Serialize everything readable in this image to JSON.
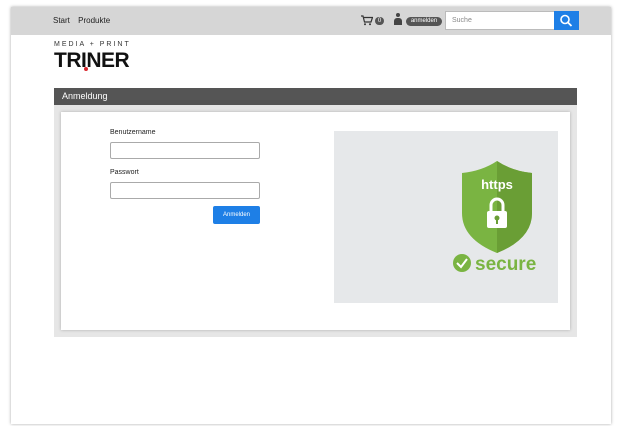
{
  "nav": {
    "start": "Start",
    "products": "Produkte"
  },
  "header": {
    "cart_count": "0",
    "login_label": "anmelden",
    "search_placeholder": "Suche"
  },
  "logo": {
    "top": "MEDIA + PRINT",
    "main": "TRINER"
  },
  "section": {
    "title": "Anmeldung"
  },
  "form": {
    "username_label": "Benutzername",
    "password_label": "Passwort",
    "submit_label": "Anmelden",
    "username_value": "",
    "password_value": ""
  },
  "image": {
    "https_text": "https",
    "secure_text": "secure"
  },
  "colors": {
    "accent": "#1e7fe6",
    "shield_green": "#7ab442",
    "brand_red": "#d8262d"
  },
  "icons": [
    "cart-icon",
    "user-icon",
    "search-icon",
    "lock-icon",
    "checkmark-icon"
  ]
}
